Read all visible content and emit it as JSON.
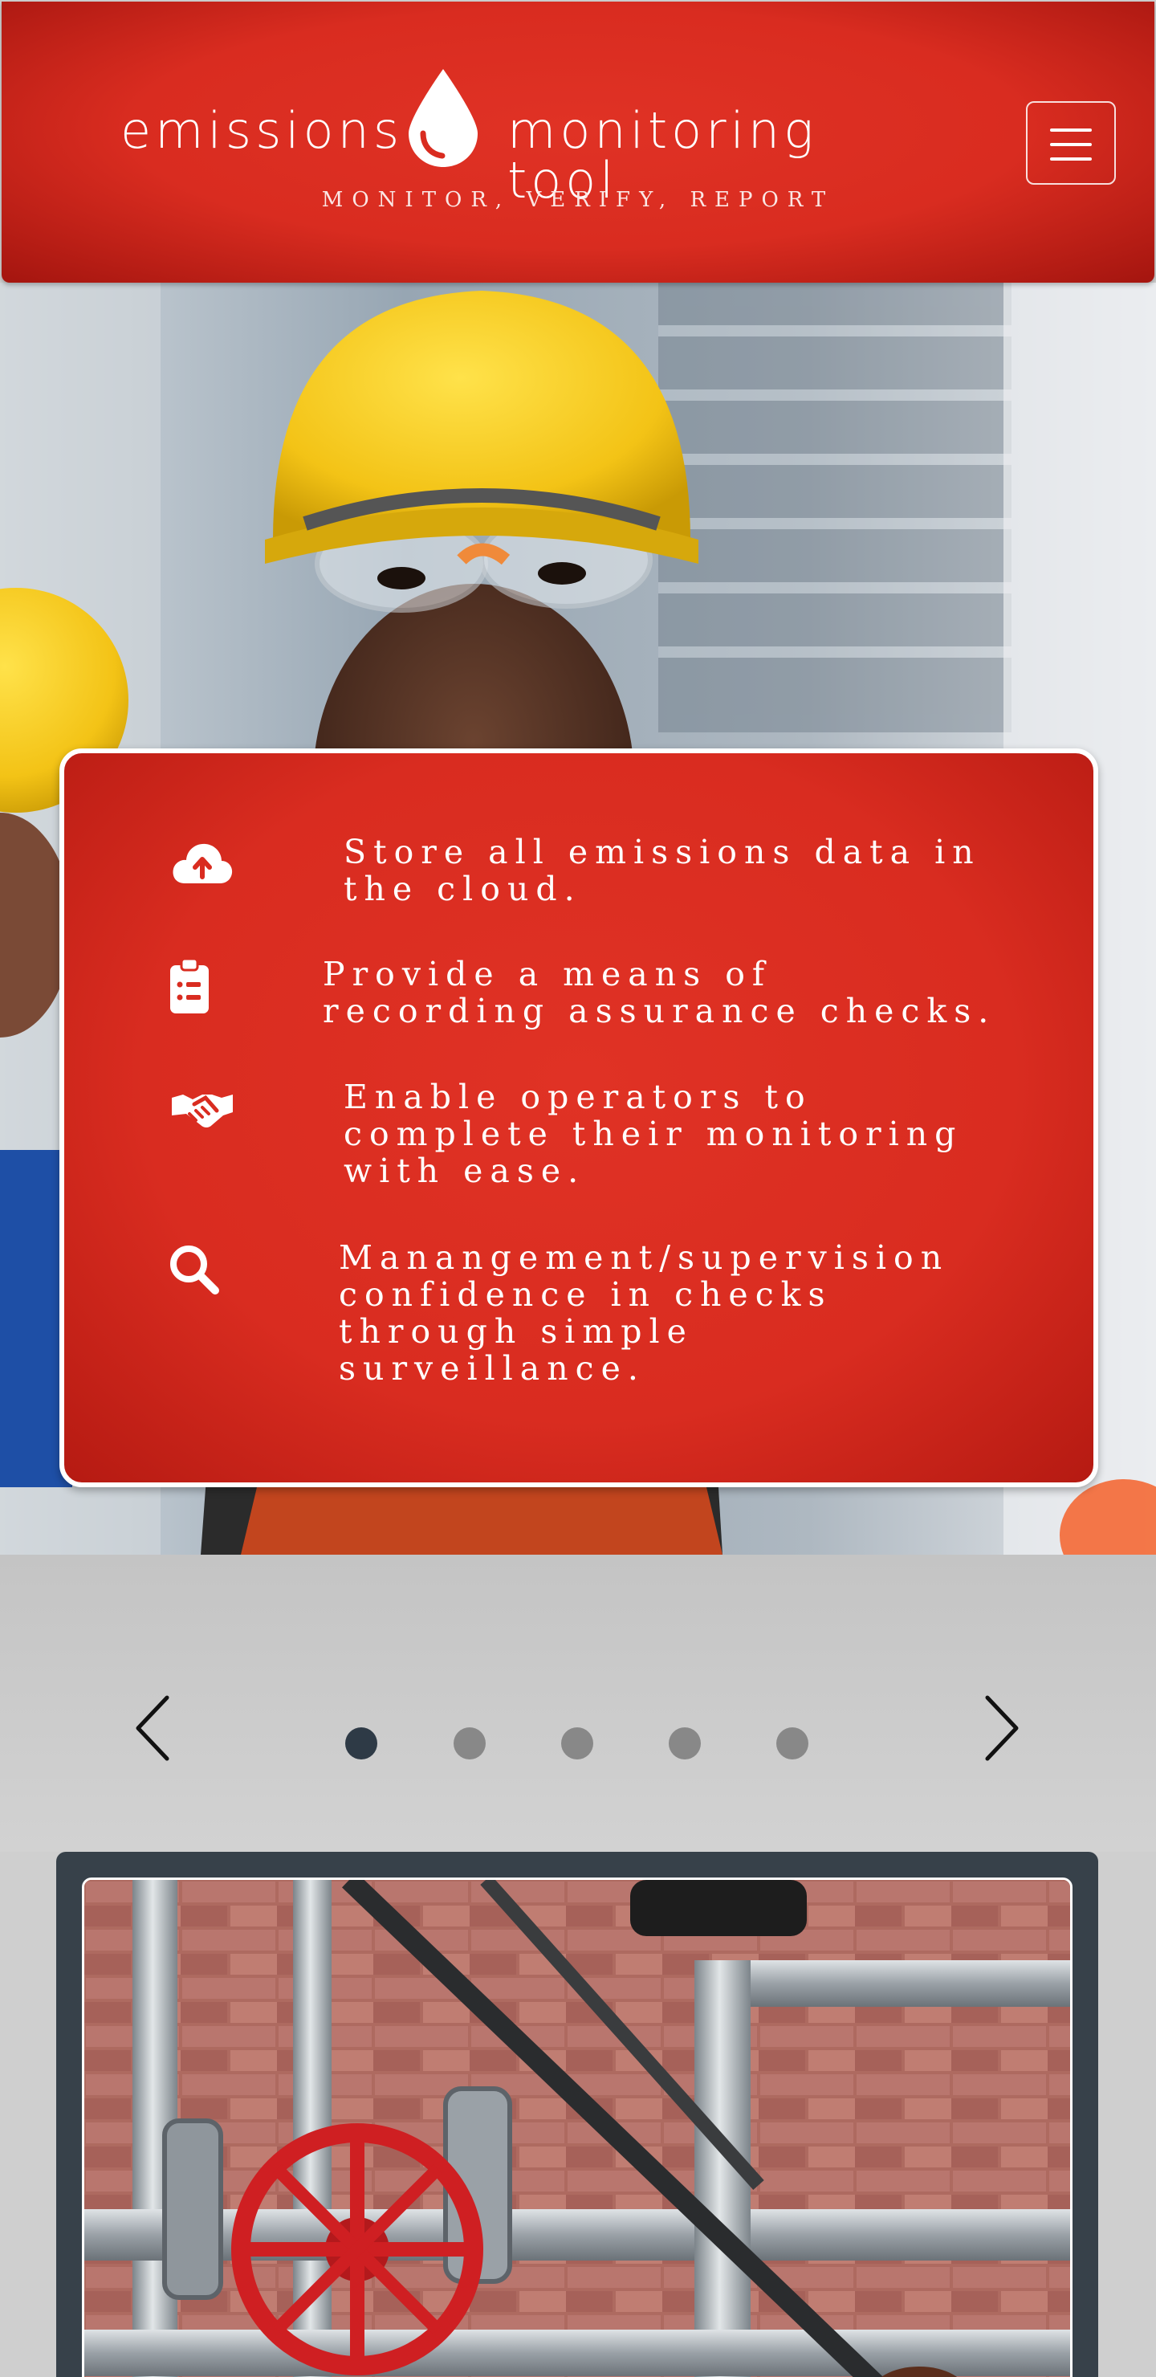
{
  "header": {
    "brand_left": "emissions",
    "brand_right": "monitoring tool",
    "tagline": "MONITOR, VERIFY, REPORT",
    "logo_icon": "water-drop-icon",
    "menu_icon": "hamburger-menu-icon"
  },
  "features": [
    {
      "icon": "cloud-upload-icon",
      "lines": [
        "Store all emissions data in",
        "the cloud."
      ]
    },
    {
      "icon": "clipboard-list-icon",
      "lines": [
        "Provide a means of",
        "recording assurance checks."
      ]
    },
    {
      "icon": "handshake-icon",
      "lines": [
        "Enable operators to",
        "complete their monitoring",
        "with ease."
      ]
    },
    {
      "icon": "search-icon",
      "lines": [
        "Manangement/supervision",
        "confidence in checks",
        "through simple",
        "surveillance."
      ]
    }
  ],
  "carousel": {
    "prev_icon": "chevron-left-icon",
    "next_icon": "chevron-right-icon",
    "slide_count": 5,
    "active_slide": 1
  },
  "colors": {
    "brand_red": "#d92c20",
    "dark_slate": "#37414a",
    "active_dot": "#2e3a46",
    "inactive_dot": "#888888"
  }
}
